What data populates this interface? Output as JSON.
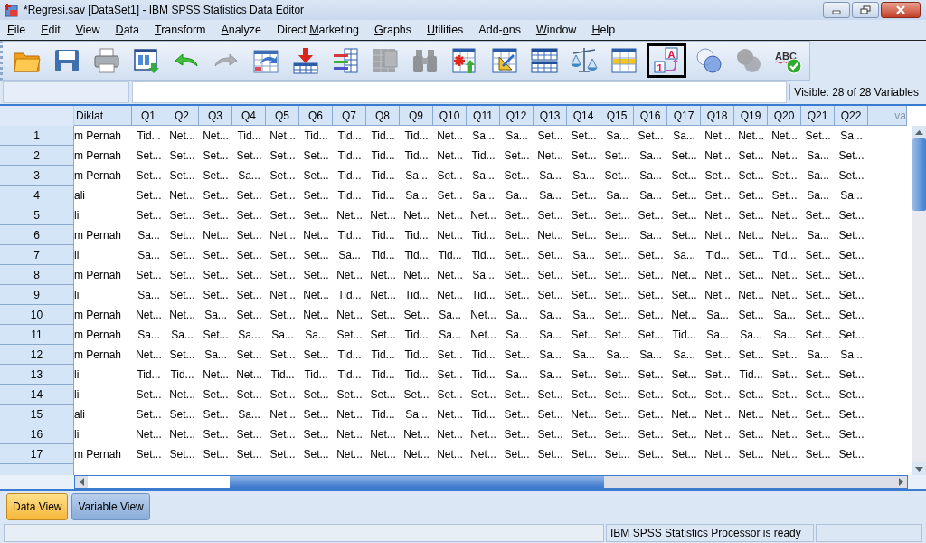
{
  "window": {
    "title": "*Regresi.sav [DataSet1] - IBM SPSS Statistics Data Editor"
  },
  "menu": [
    {
      "key": "F",
      "rest": "ile"
    },
    {
      "key": "E",
      "rest": "dit"
    },
    {
      "key": "V",
      "rest": "iew"
    },
    {
      "key": "D",
      "rest": "ata"
    },
    {
      "key": "T",
      "rest": "ransform"
    },
    {
      "key": "A",
      "rest": "nalyze"
    },
    {
      "before": "Direct ",
      "key": "M",
      "rest": "arketing"
    },
    {
      "key": "G",
      "rest": "raphs"
    },
    {
      "key": "U",
      "rest": "tilities"
    },
    {
      "before": "Add-",
      "key": "o",
      "rest": "ns"
    },
    {
      "key": "W",
      "rest": "indow"
    },
    {
      "key": "H",
      "rest": "elp"
    }
  ],
  "toolbar": [
    {
      "kind": "open",
      "disabled": false,
      "selected": false
    },
    {
      "kind": "save",
      "disabled": false,
      "selected": false
    },
    {
      "kind": "print",
      "disabled": false,
      "selected": false
    },
    {
      "kind": "recall",
      "disabled": false,
      "selected": false
    },
    {
      "kind": "undo",
      "disabled": false,
      "selected": false
    },
    {
      "kind": "redo",
      "disabled": true,
      "selected": false
    },
    {
      "kind": "goto_case",
      "disabled": false,
      "selected": false
    },
    {
      "kind": "insert_cases",
      "disabled": false,
      "selected": false
    },
    {
      "kind": "variables",
      "disabled": false,
      "selected": false
    },
    {
      "kind": "grid_mu",
      "disabled": true,
      "selected": false
    },
    {
      "kind": "binoculars",
      "disabled": true,
      "selected": false
    },
    {
      "kind": "insert_variable",
      "disabled": false,
      "selected": false
    },
    {
      "kind": "split",
      "disabled": false,
      "selected": false
    },
    {
      "kind": "double_grid",
      "disabled": false,
      "selected": false
    },
    {
      "kind": "scales",
      "disabled": false,
      "selected": false
    },
    {
      "kind": "select_cases",
      "disabled": false,
      "selected": false
    },
    {
      "kind": "value_labels",
      "disabled": false,
      "selected": true,
      "glyphs": [
        "A",
        "1"
      ]
    },
    {
      "kind": "circles",
      "disabled": false,
      "selected": false
    },
    {
      "kind": "gray_circles",
      "disabled": true,
      "selected": false
    },
    {
      "kind": "spell",
      "disabled": false,
      "selected": false,
      "glyphs": [
        "ABC"
      ]
    }
  ],
  "visible_label": "Visible: 28 of 28 Variables",
  "table": {
    "columns": [
      "Diklat",
      "Q1",
      "Q2",
      "Q3",
      "Q4",
      "Q5",
      "Q6",
      "Q7",
      "Q8",
      "Q9",
      "Q10",
      "Q11",
      "Q12",
      "Q13",
      "Q14",
      "Q15",
      "Q16",
      "Q17",
      "Q18",
      "Q19",
      "Q20",
      "Q21",
      "Q22",
      "va"
    ],
    "rows": [
      {
        "number": "1",
        "cells": [
          "m Pernah",
          "Tid...",
          "Net...",
          "Net...",
          "Tid...",
          "Net...",
          "Tid...",
          "Tid...",
          "Tid...",
          "Tid...",
          "Net...",
          "Sa...",
          "Sa...",
          "Set...",
          "Set...",
          "Sa...",
          "Set...",
          "Sa...",
          "Net...",
          "Net...",
          "Net...",
          "Set...",
          "Sa..."
        ]
      },
      {
        "number": "2",
        "cells": [
          "m Pernah",
          "Set...",
          "Set...",
          "Set...",
          "Set...",
          "Set...",
          "Set...",
          "Tid...",
          "Tid...",
          "Tid...",
          "Net...",
          "Tid...",
          "Set...",
          "Net...",
          "Set...",
          "Set...",
          "Sa...",
          "Set...",
          "Net...",
          "Set...",
          "Net...",
          "Sa...",
          "Set..."
        ]
      },
      {
        "number": "3",
        "cells": [
          "m Pernah",
          "Set...",
          "Set...",
          "Set...",
          "Sa...",
          "Set...",
          "Set...",
          "Tid...",
          "Tid...",
          "Sa...",
          "Set...",
          "Sa...",
          "Set...",
          "Sa...",
          "Sa...",
          "Set...",
          "Sa...",
          "Set...",
          "Set...",
          "Set...",
          "Set...",
          "Sa...",
          "Set..."
        ]
      },
      {
        "number": "4",
        "cells": [
          "ali",
          "Set...",
          "Net...",
          "Set...",
          "Set...",
          "Set...",
          "Set...",
          "Tid...",
          "Tid...",
          "Sa...",
          "Set...",
          "Sa...",
          "Sa...",
          "Sa...",
          "Set...",
          "Sa...",
          "Sa...",
          "Set...",
          "Set...",
          "Set...",
          "Set...",
          "Sa...",
          "Sa..."
        ]
      },
      {
        "number": "5",
        "cells": [
          "li",
          "Set...",
          "Set...",
          "Set...",
          "Set...",
          "Set...",
          "Set...",
          "Net...",
          "Net...",
          "Net...",
          "Net...",
          "Net...",
          "Set...",
          "Set...",
          "Set...",
          "Set...",
          "Set...",
          "Set...",
          "Net...",
          "Set...",
          "Net...",
          "Set...",
          "Set..."
        ]
      },
      {
        "number": "6",
        "cells": [
          "m Pernah",
          "Sa...",
          "Set...",
          "Net...",
          "Set...",
          "Net...",
          "Net...",
          "Tid...",
          "Tid...",
          "Tid...",
          "Net...",
          "Tid...",
          "Set...",
          "Net...",
          "Set...",
          "Set...",
          "Sa...",
          "Set...",
          "Net...",
          "Net...",
          "Net...",
          "Sa...",
          "Set..."
        ]
      },
      {
        "number": "7",
        "cells": [
          "li",
          "Sa...",
          "Set...",
          "Set...",
          "Set...",
          "Set...",
          "Set...",
          "Sa...",
          "Tid...",
          "Tid...",
          "Tid...",
          "Tid...",
          "Set...",
          "Set...",
          "Sa...",
          "Set...",
          "Set...",
          "Sa...",
          "Tid...",
          "Set...",
          "Tid...",
          "Set...",
          "Set..."
        ]
      },
      {
        "number": "8",
        "cells": [
          "m Pernah",
          "Set...",
          "Set...",
          "Set...",
          "Set...",
          "Set...",
          "Set...",
          "Net...",
          "Net...",
          "Net...",
          "Net...",
          "Sa...",
          "Set...",
          "Set...",
          "Set...",
          "Set...",
          "Set...",
          "Net...",
          "Net...",
          "Set...",
          "Net...",
          "Set...",
          "Set..."
        ]
      },
      {
        "number": "9",
        "cells": [
          "li",
          "Sa...",
          "Set...",
          "Set...",
          "Set...",
          "Net...",
          "Net...",
          "Tid...",
          "Net...",
          "Tid...",
          "Net...",
          "Tid...",
          "Set...",
          "Set...",
          "Set...",
          "Set...",
          "Set...",
          "Set...",
          "Net...",
          "Net...",
          "Net...",
          "Set...",
          "Set..."
        ]
      },
      {
        "number": "10",
        "cells": [
          "m Pernah",
          "Net...",
          "Net...",
          "Sa...",
          "Set...",
          "Set...",
          "Net...",
          "Net...",
          "Set...",
          "Set...",
          "Sa...",
          "Net...",
          "Sa...",
          "Sa...",
          "Sa...",
          "Set...",
          "Set...",
          "Net...",
          "Sa...",
          "Set...",
          "Sa...",
          "Set...",
          "Set..."
        ]
      },
      {
        "number": "11",
        "cells": [
          "m Pernah",
          "Sa...",
          "Sa...",
          "Set...",
          "Sa...",
          "Sa...",
          "Sa...",
          "Set...",
          "Set...",
          "Tid...",
          "Sa...",
          "Net...",
          "Sa...",
          "Sa...",
          "Set...",
          "Set...",
          "Set...",
          "Tid...",
          "Sa...",
          "Sa...",
          "Sa...",
          "Set...",
          "Set..."
        ]
      },
      {
        "number": "12",
        "cells": [
          "m Pernah",
          "Net...",
          "Set...",
          "Sa...",
          "Set...",
          "Set...",
          "Set...",
          "Tid...",
          "Tid...",
          "Tid...",
          "Set...",
          "Tid...",
          "Set...",
          "Sa...",
          "Sa...",
          "Sa...",
          "Sa...",
          "Sa...",
          "Set...",
          "Set...",
          "Set...",
          "Sa...",
          "Sa..."
        ]
      },
      {
        "number": "13",
        "cells": [
          "li",
          "Tid...",
          "Tid...",
          "Net...",
          "Net...",
          "Tid...",
          "Tid...",
          "Tid...",
          "Tid...",
          "Tid...",
          "Set...",
          "Tid...",
          "Sa...",
          "Sa...",
          "Set...",
          "Set...",
          "Set...",
          "Set...",
          "Set...",
          "Tid...",
          "Set...",
          "Set...",
          "Set..."
        ]
      },
      {
        "number": "14",
        "cells": [
          "li",
          "Set...",
          "Net...",
          "Set...",
          "Set...",
          "Set...",
          "Set...",
          "Set...",
          "Set...",
          "Set...",
          "Set...",
          "Set...",
          "Set...",
          "Set...",
          "Set...",
          "Set...",
          "Set...",
          "Set...",
          "Set...",
          "Set...",
          "Set...",
          "Set...",
          "Set..."
        ]
      },
      {
        "number": "15",
        "cells": [
          "ali",
          "Set...",
          "Set...",
          "Set...",
          "Sa...",
          "Net...",
          "Set...",
          "Net...",
          "Tid...",
          "Sa...",
          "Net...",
          "Tid...",
          "Set...",
          "Set...",
          "Net...",
          "Set...",
          "Set...",
          "Net...",
          "Net...",
          "Net...",
          "Net...",
          "Set...",
          "Set..."
        ]
      },
      {
        "number": "16",
        "cells": [
          "li",
          "Net...",
          "Net...",
          "Set...",
          "Set...",
          "Set...",
          "Set...",
          "Net...",
          "Net...",
          "Net...",
          "Net...",
          "Net...",
          "Set...",
          "Set...",
          "Set...",
          "Set...",
          "Set...",
          "Set...",
          "Net...",
          "Set...",
          "Net...",
          "Set...",
          "Set..."
        ]
      },
      {
        "number": "17",
        "cells": [
          "m Pernah",
          "Set...",
          "Set...",
          "Set...",
          "Set...",
          "Set...",
          "Set...",
          "Net...",
          "Net...",
          "Net...",
          "Net...",
          "Net...",
          "Set...",
          "Set...",
          "Set...",
          "Set...",
          "Set...",
          "Set...",
          "Net...",
          "Set...",
          "Net...",
          "Set...",
          "Set..."
        ]
      }
    ]
  },
  "tabs": [
    {
      "label": "Data View",
      "selected": true
    },
    {
      "label": "Variable View",
      "selected": false
    }
  ],
  "status_bar": {
    "message": "IBM SPSS Statistics Processor is ready"
  }
}
